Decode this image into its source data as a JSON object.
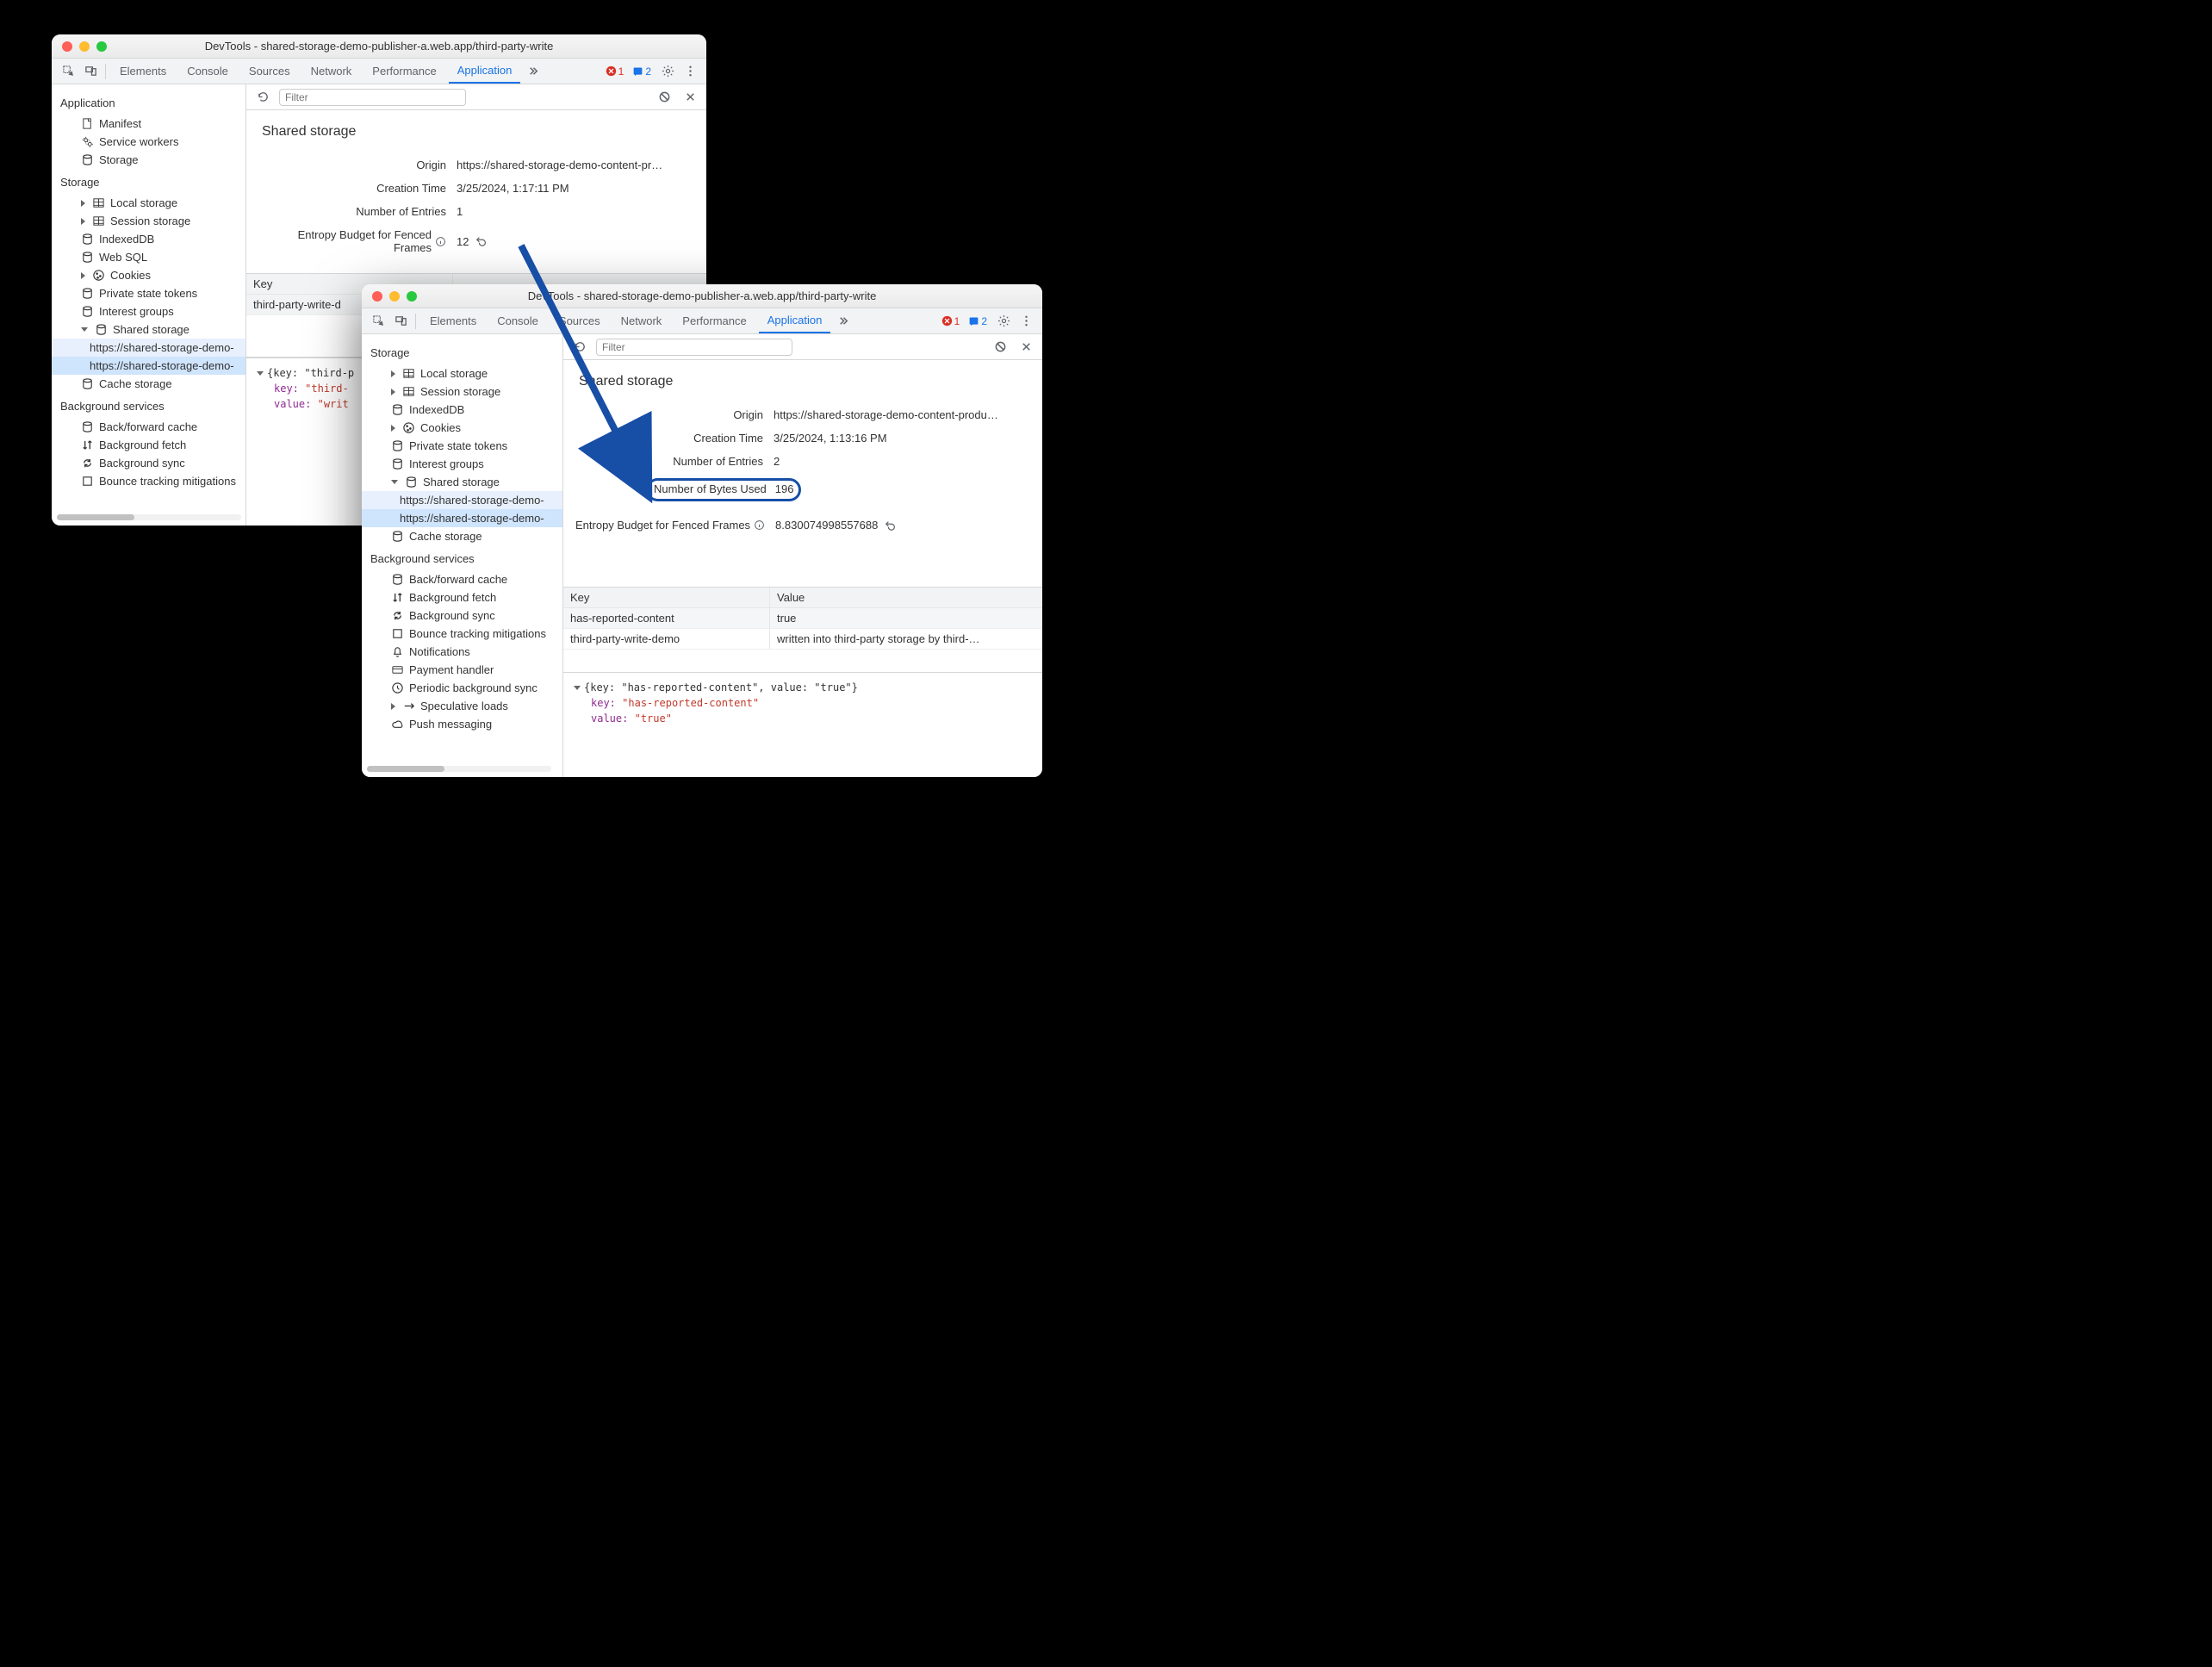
{
  "win1": {
    "title": "DevTools - shared-storage-demo-publisher-a.web.app/third-party-write",
    "tabs": [
      "Elements",
      "Console",
      "Sources",
      "Network",
      "Performance",
      "Application"
    ],
    "err_count": "1",
    "note_count": "2",
    "filter_placeholder": "Filter",
    "sidebar": {
      "app_title": "Application",
      "app_items": [
        "Manifest",
        "Service workers",
        "Storage"
      ],
      "storage_title": "Storage",
      "storage_items": [
        "Local storage",
        "Session storage",
        "IndexedDB",
        "Web SQL",
        "Cookies",
        "Private state tokens",
        "Interest groups",
        "Shared storage"
      ],
      "shared_children": [
        "https://shared-storage-demo-",
        "https://shared-storage-demo-"
      ],
      "cache": "Cache storage",
      "bg_title": "Background services",
      "bg_items": [
        "Back/forward cache",
        "Background fetch",
        "Background sync",
        "Bounce tracking mitigations"
      ]
    },
    "panel": {
      "title": "Shared storage",
      "origin_k": "Origin",
      "origin_v": "https://shared-storage-demo-content-pr…",
      "ctime_k": "Creation Time",
      "ctime_v": "3/25/2024, 1:17:11 PM",
      "nentries_k": "Number of Entries",
      "nentries_v": "1",
      "entropy_k": "Entropy Budget for Fenced Frames",
      "entropy_v": "12"
    },
    "table": {
      "col_key": "Key",
      "row_key": "third-party-write-d"
    },
    "obj": {
      "header": "{key: \"third-p",
      "key_k": "key:",
      "key_v": "\"third-",
      "val_k": "value:",
      "val_v": "\"writ"
    }
  },
  "win2": {
    "title": "DevTools - shared-storage-demo-publisher-a.web.app/third-party-write",
    "tabs": [
      "Elements",
      "Console",
      "Sources",
      "Network",
      "Performance",
      "Application"
    ],
    "err_count": "1",
    "note_count": "2",
    "filter_placeholder": "Filter",
    "sidebar": {
      "storage_title": "Storage",
      "storage_items": [
        "Local storage",
        "Session storage",
        "IndexedDB",
        "Cookies",
        "Private state tokens",
        "Interest groups",
        "Shared storage"
      ],
      "shared_children": [
        "https://shared-storage-demo-",
        "https://shared-storage-demo-"
      ],
      "cache": "Cache storage",
      "bg_title": "Background services",
      "bg_items": [
        "Back/forward cache",
        "Background fetch",
        "Background sync",
        "Bounce tracking mitigations",
        "Notifications",
        "Payment handler",
        "Periodic background sync",
        "Speculative loads",
        "Push messaging"
      ]
    },
    "panel": {
      "title": "Shared storage",
      "origin_k": "Origin",
      "origin_v": "https://shared-storage-demo-content-produ…",
      "ctime_k": "Creation Time",
      "ctime_v": "3/25/2024, 1:13:16 PM",
      "nentries_k": "Number of Entries",
      "nentries_v": "2",
      "bytes_k": "Number of Bytes Used",
      "bytes_v": "196",
      "entropy_k": "Entropy Budget for Fenced Frames",
      "entropy_v": "8.830074998557688"
    },
    "table": {
      "col_key": "Key",
      "col_val": "Value",
      "rows": [
        {
          "k": "has-reported-content",
          "v": "true"
        },
        {
          "k": "third-party-write-demo",
          "v": "written into third-party storage by third-…"
        }
      ]
    },
    "obj": {
      "header": "{key: \"has-reported-content\", value: \"true\"}",
      "key_k": "key:",
      "key_v": "\"has-reported-content\"",
      "val_k": "value:",
      "val_v": "\"true\""
    }
  }
}
